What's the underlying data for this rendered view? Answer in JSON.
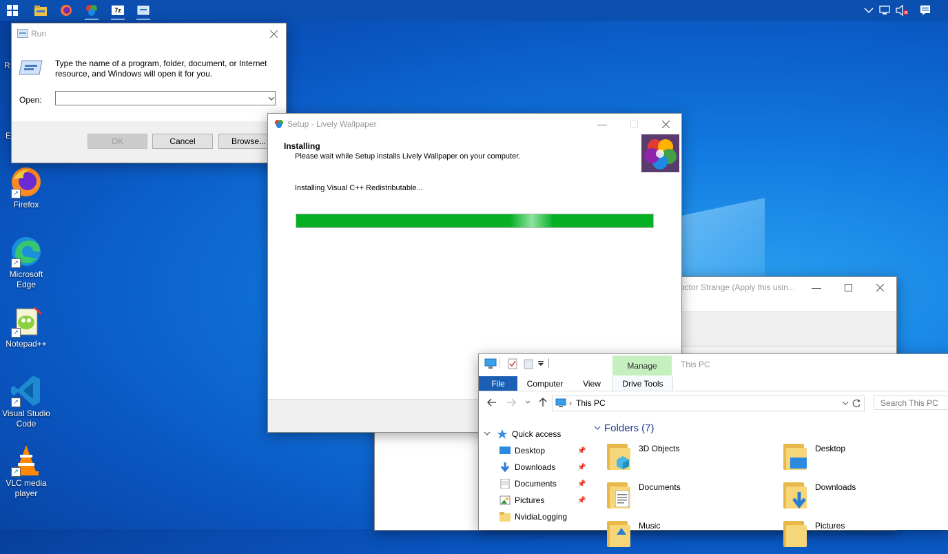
{
  "desktop": {
    "icons": [
      {
        "label": "Firefox"
      },
      {
        "label": "Microsoft Edge"
      },
      {
        "label": "Notepad++"
      },
      {
        "label": "Visual Studio Code"
      },
      {
        "label": "VLC media player"
      }
    ],
    "partial_left_labels": [
      "R",
      "E"
    ]
  },
  "taskbar": {
    "apps": [
      "start-icon",
      "file-explorer-icon",
      "firefox-icon",
      "lively-wallpaper-icon",
      "7zip-icon",
      "run-icon"
    ],
    "app_7zip_text": "7z",
    "tray": [
      "chevron-up-icon",
      "network-icon",
      "volume-muted-icon",
      "notifications-icon"
    ]
  },
  "run_dialog": {
    "title": "Run",
    "description": "Type the name of a program, folder, document, or Internet resource, and Windows will open it for you.",
    "open_label": "Open:",
    "open_value": "",
    "ok_label": "OK",
    "cancel_label": "Cancel",
    "browse_label": "Browse..."
  },
  "setup_dialog": {
    "title": "Setup - Lively Wallpaper",
    "heading": "Installing",
    "subheading": "Please wait while Setup installs Lively Wallpaper on your computer.",
    "status": "Installing Visual C++ Redistributable...",
    "progress": 1.0
  },
  "background_window": {
    "title": "octor Strange (Apply this usin..."
  },
  "explorer": {
    "location_title": "This PC",
    "tabs": {
      "file": "File",
      "computer": "Computer",
      "view": "View",
      "manage": "Manage",
      "drive_tools": "Drive Tools"
    },
    "address": "This PC",
    "search_placeholder": "Search This PC",
    "nav": {
      "quick_access": "Quick access",
      "items": [
        {
          "label": "Desktop",
          "pinned": true
        },
        {
          "label": "Downloads",
          "pinned": true
        },
        {
          "label": "Documents",
          "pinned": true
        },
        {
          "label": "Pictures",
          "pinned": true
        },
        {
          "label": "NvidiaLogging",
          "pinned": false
        }
      ]
    },
    "folders_header": "Folders (7)",
    "folders": [
      {
        "label": "3D Objects"
      },
      {
        "label": "Desktop"
      },
      {
        "label": "Documents"
      },
      {
        "label": "Downloads"
      },
      {
        "label": "Music"
      },
      {
        "label": "Pictures"
      }
    ]
  },
  "colors": {
    "taskbar": "#0b4fb0",
    "progress_green": "#06b025",
    "manage_tab": "#c6efc0",
    "file_tab": "#1a5fb4"
  }
}
